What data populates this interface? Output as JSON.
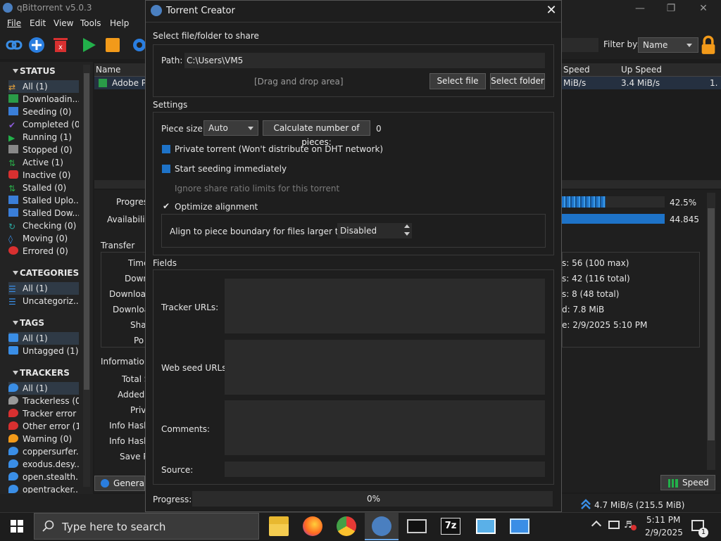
{
  "app": {
    "title": "qBittorrent v5.0.3"
  },
  "menu": [
    "File",
    "Edit",
    "View",
    "Tools",
    "Help"
  ],
  "toolbar": {
    "filter_label": "Filter by:",
    "filter_value": "Name"
  },
  "sidebar": {
    "status_header": "STATUS",
    "status_items": [
      "All (1)",
      "Downloadin...",
      "Seeding (0)",
      "Completed (0)",
      "Running (1)",
      "Stopped (0)",
      "Active (1)",
      "Inactive (0)",
      "Stalled (0)",
      "Stalled Uplo...",
      "Stalled Dow...",
      "Checking (0)",
      "Moving (0)",
      "Errored (0)"
    ],
    "categories_header": "CATEGORIES",
    "category_items": [
      "All (1)",
      "Uncategoriz..."
    ],
    "tags_header": "TAGS",
    "tag_items": [
      "All (1)",
      "Untagged (1)"
    ],
    "trackers_header": "TRACKERS",
    "tracker_items": [
      "All (1)",
      "Trackerless (0)",
      "Tracker error ...",
      "Other error (1)",
      "Warning (0)",
      "coppersurfer...",
      "exodus.desy...",
      "open.stealth....",
      "opentracker...."
    ]
  },
  "transfer_list": {
    "col_name": "Name",
    "col_down_speed": "Speed",
    "col_up_speed": "Up Speed",
    "row_name": "Adobe Pl",
    "row_down_speed": "MiB/s",
    "row_up_speed": "3.4 MiB/s",
    "row_extra": "1."
  },
  "details": {
    "progress_label": "Progres",
    "availability_label": "Availability",
    "progress_value": "42.5%",
    "progress_fraction": 0.425,
    "availability_value": "44.845",
    "transfer_header": "Transfer",
    "transfer_labels": [
      "Time",
      "Down",
      "Download",
      "Download",
      "Shar",
      "Po"
    ],
    "info_header": "Information",
    "info_labels": [
      "Total S",
      "Added",
      "Priv",
      "Info Hash",
      "Info Hash",
      "Save P"
    ],
    "right_values": [
      "s: 56 (100 max)",
      "s: 42 (116 total)",
      "s: 8 (48 total)",
      "d: 7.8 MiB",
      "e: 2/9/2025 5:10 PM"
    ],
    "general_tab": "General",
    "speed_tab": "Speed"
  },
  "statusbar": {
    "speed": "4.7 MiB/s (215.5 MiB)"
  },
  "taskbar": {
    "search_placeholder": "Type here to search",
    "time": "5:11 PM",
    "date": "2/9/2025",
    "notif_count": "1"
  },
  "dialog": {
    "title": "Torrent Creator",
    "select_group": "Select file/folder to share",
    "path_label": "Path:",
    "path_value": "C:\\Users\\VM5",
    "drag_drop": "[Drag and drop area]",
    "select_file": "Select file",
    "select_folder": "Select folder",
    "settings_group": "Settings",
    "piece_size_label": "Piece size:",
    "piece_size_value": "Auto",
    "calc_pieces": "Calculate number of pieces:",
    "pieces_count": "0",
    "private_torrent": "Private torrent (Won't distribute on DHT network)",
    "start_seeding": "Start seeding immediately",
    "ignore_ratio": "Ignore share ratio limits for this torrent",
    "optimize_alignment": "Optimize alignment",
    "align_label": "Align to piece boundary for files larger than:",
    "align_value": "Disabled",
    "fields_group": "Fields",
    "tracker_urls": "Tracker URLs:",
    "web_seed_urls": "Web seed URLs:",
    "comments": "Comments:",
    "source": "Source:",
    "progress_label": "Progress:",
    "progress_value": "0%"
  },
  "colors": {
    "accent": "#1e73c8",
    "progress_bar": "#1b4f8c"
  }
}
